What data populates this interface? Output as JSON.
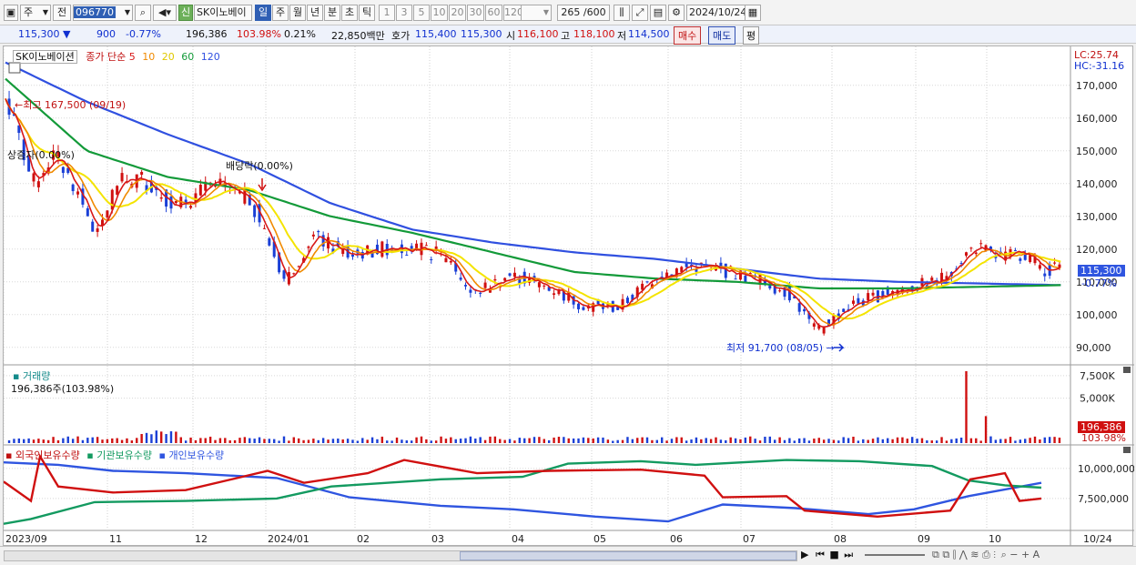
{
  "toolbar": {
    "period_type": "주",
    "market": "전",
    "stock_code": "096770",
    "new_label": "신",
    "stock_name": "SK이노베이",
    "timeframes": [
      "일",
      "주",
      "월",
      "년",
      "분",
      "초",
      "틱"
    ],
    "selected_timeframe": "일",
    "minute_options": [
      "1",
      "3",
      "5",
      "10",
      "20",
      "30",
      "60",
      "120"
    ],
    "count_display": "265 /600",
    "date": "2024/10/24"
  },
  "info": {
    "price": "115,300 ▼",
    "change": "900",
    "change_pct": "-0.77%",
    "volume": "196,386",
    "volume_ratio": "103.98%",
    "turnover": "0.21%",
    "amount": "22,850백만",
    "quote_label": "호가",
    "ask": "115,400",
    "bid": "115,300",
    "open_label": "시",
    "open": "116,100",
    "high_label": "고",
    "high": "118,100",
    "low_label": "저",
    "low": "114,500",
    "buy_button": "매수",
    "sell_button": "매도",
    "eval_button": "평"
  },
  "price_panel": {
    "title": "SK이노베이션",
    "ma_label": "종가 단순",
    "ma_periods": [
      "5",
      "10",
      "20",
      "60",
      "120"
    ],
    "lc": "LC:25.74",
    "hc": "HC:-31.16",
    "high_annotation": "최고 167,500 (09/19)",
    "low_annotation": "최저 91,700 (08/05)",
    "ex_dividend": "배당락(0.00%)",
    "ex_rights": "상증자(0.00%)",
    "price_tag": "115,300",
    "price_tag_pct": "-0.77%",
    "y_ticks": [
      "170,000",
      "160,000",
      "150,000",
      "140,000",
      "130,000",
      "120,000",
      "110,000",
      "100,000",
      "90,000"
    ]
  },
  "volume_panel": {
    "title": "거래량",
    "value": "196,386주(103.98%)",
    "y_ticks": [
      "7,500K",
      "5,000K"
    ],
    "tag_value": "196,386",
    "tag_pct": "103.98%"
  },
  "holdings_panel": {
    "series_labels": [
      "외국인보유수량",
      "기관보유수량",
      "개인보유수량"
    ],
    "y_ticks": [
      "10,000,000",
      "7,500,000"
    ]
  },
  "x_axis": [
    "2023/09",
    "11",
    "12",
    "2024/01",
    "02",
    "03",
    "04",
    "05",
    "06",
    "07",
    "08",
    "09",
    "10",
    "10/24"
  ],
  "colors": {
    "up": "#d01010",
    "down": "#1a3fd6",
    "ma5": "#d81818",
    "ma10": "#f08a00",
    "ma20": "#f4e400",
    "ma60": "#139a39",
    "ma120": "#3050e0",
    "foreign": "#d01010",
    "institution": "#139a60",
    "individual": "#2f55e0"
  },
  "chart_data": {
    "type": "line",
    "series": [
      {
        "name": "종가",
        "x": [
          "2023/09",
          "11",
          "12",
          "2024/01",
          "02",
          "03",
          "04",
          "05",
          "06",
          "07",
          "08",
          "09",
          "10",
          "10/24"
        ],
        "values": [
          165000,
          124000,
          140000,
          139000,
          110000,
          121000,
          118000,
          108000,
          102000,
          113000,
          93000,
          108000,
          120000,
          115300
        ]
      },
      {
        "name": "120",
        "x": [
          "2023/09",
          "11",
          "12",
          "2024/01",
          "02",
          "03",
          "04",
          "05",
          "06",
          "07",
          "08",
          "09",
          "10",
          "10/24"
        ],
        "values": [
          177000,
          165000,
          155000,
          146000,
          134000,
          126000,
          122000,
          119000,
          117000,
          114000,
          111000,
          110000,
          109500,
          109000
        ]
      },
      {
        "name": "60",
        "x": [
          "2023/09",
          "11",
          "12",
          "2024/01",
          "02",
          "03",
          "04",
          "05",
          "06",
          "07",
          "08",
          "09",
          "10",
          "10/24"
        ],
        "values": [
          172000,
          150000,
          142000,
          138000,
          130000,
          125000,
          119000,
          113000,
          111000,
          110000,
          108000,
          108000,
          108500,
          109000
        ]
      }
    ],
    "ylim": [
      88000,
      178000
    ]
  }
}
